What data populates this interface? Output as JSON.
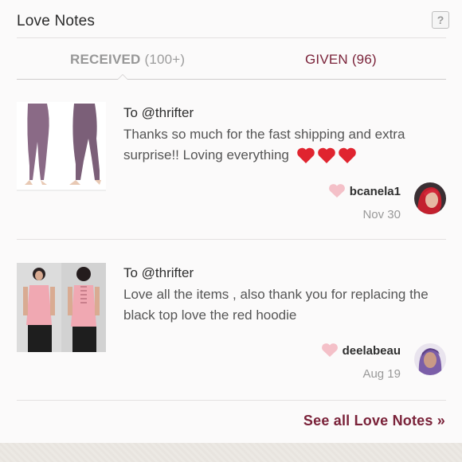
{
  "header": {
    "title": "Love Notes",
    "help_icon": "help-icon"
  },
  "tabs": {
    "received": {
      "label": "RECEIVED",
      "count": "(100+)"
    },
    "given": {
      "label": "GIVEN (96)"
    }
  },
  "notes": [
    {
      "to": "To @thrifter",
      "body": "Thanks so much for the fast shipping and extra surprise!! Loving everything",
      "hearts": [
        "heart-emoji",
        "heart-emoji",
        "heart-emoji"
      ],
      "author": "bcanela1",
      "date": "Nov 30",
      "thumb": "leggings-product-image",
      "avatar_color": "#c3202e"
    },
    {
      "to": "To @thrifter",
      "body": "Love all the items , also thank you for replacing the black top love the red hoodie",
      "author": "deelabeau",
      "date": "Aug 19",
      "thumb": "pink-tank-product-image",
      "avatar_color": "#7b5ea8"
    }
  ],
  "footer": {
    "see_all": "See all Love Notes »"
  },
  "colors": {
    "accent": "#7a2239",
    "like_heart": "#f4c0c8",
    "emoji_heart": "#e0242f"
  }
}
